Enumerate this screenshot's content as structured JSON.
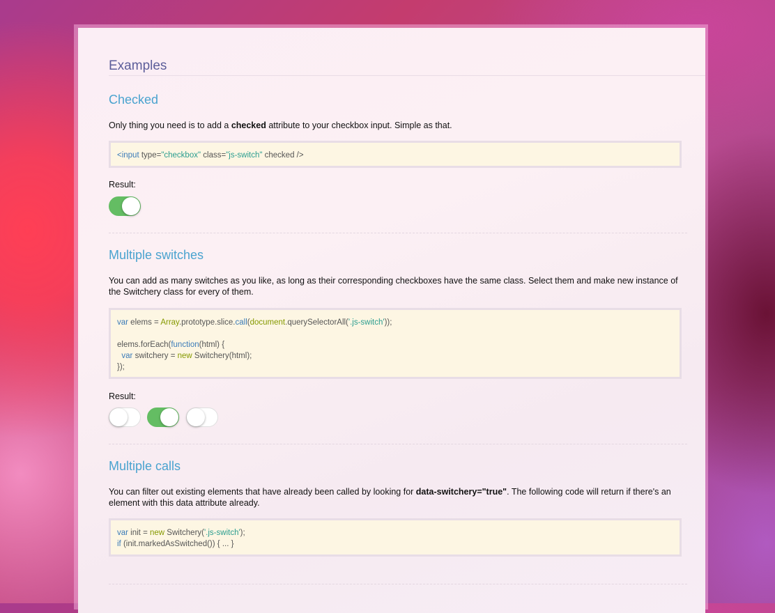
{
  "headings": {
    "examples": "Examples"
  },
  "checked": {
    "title": "Checked",
    "desc_before": "Only thing you need is to add a ",
    "desc_bold": "checked",
    "desc_after": " attribute to your checkbox input. Simple as that.",
    "code": {
      "open": "<input",
      "attr1": " type=",
      "val1": "\"checkbox\"",
      "attr2": " class=",
      "val2": "\"js-switch\"",
      "tail": " checked />"
    },
    "result_label": "Result:",
    "switch_on": true
  },
  "multiple_switches": {
    "title": "Multiple switches",
    "desc": "You can add as many switches as you like, as long as their corresponding checkboxes have the same class. Select them and make new instance of the Switchery class for every of them.",
    "code": {
      "l1_var": "var",
      "l1_a": " elems = ",
      "l1_array": "Array",
      "l1_b": ".prototype.slice.",
      "l1_call": "call",
      "l1_c": "(",
      "l1_doc": "document",
      "l1_d": ".querySelectorAll(",
      "l1_str": "'.js-switch'",
      "l1_e": "));",
      "l3_a": "elems.forEach(",
      "l3_fn": "function",
      "l3_b": "(html) {",
      "l4_var": "var",
      "l4_a": " switchery = ",
      "l4_new": "new",
      "l4_b": " Switchery(html);",
      "l5": "});"
    },
    "result_label": "Result:",
    "switches": [
      false,
      true,
      false
    ]
  },
  "multiple_calls": {
    "title": "Multiple calls",
    "desc_before": "You can filter out existing elements that have already been called by looking for ",
    "desc_bold": "data-switchery=\"true\"",
    "desc_after": ". The following code will return if there's an element with this data attribute already.",
    "code": {
      "l1_var": "var",
      "l1_a": " init = ",
      "l1_new": "new",
      "l1_b": " Switchery(",
      "l1_str": "'.js-switch'",
      "l1_c": ");",
      "l2_if": "if",
      "l2_a": " (init.markedAsSwitched()) { ... }"
    }
  },
  "colors": {
    "switch_on": "#64bd63",
    "heading": "#4aa3cf",
    "code_bg": "#fdf6e3"
  }
}
